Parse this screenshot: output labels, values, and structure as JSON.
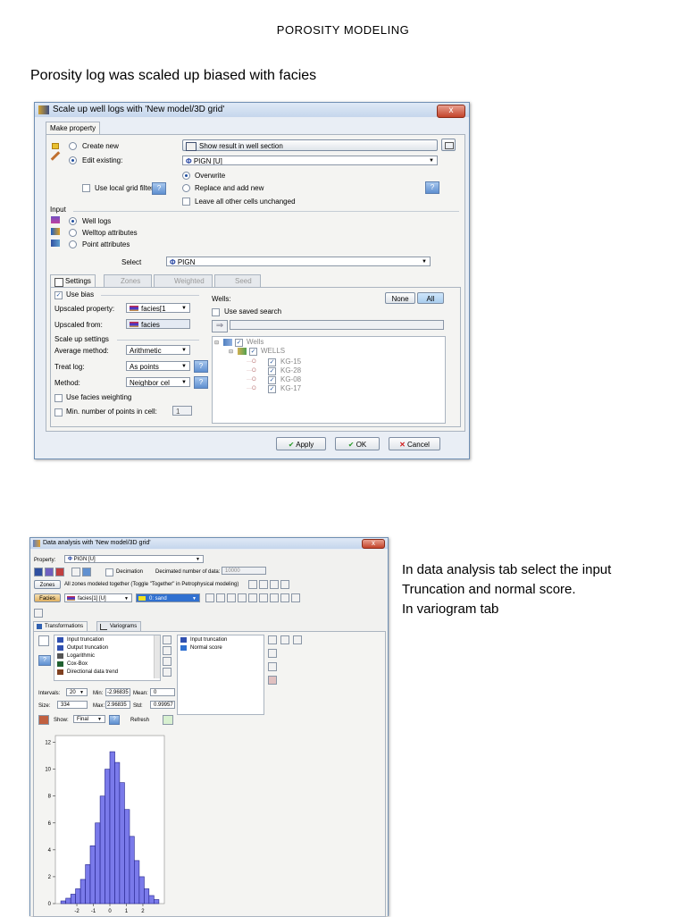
{
  "doc": {
    "title": "POROSITY MODELING",
    "subtitle": "Porosity log was scaled up biased with facies",
    "notes": [
      "In data analysis tab select the input",
      "Truncation and normal score.",
      "In variogram tab"
    ]
  },
  "dialog1": {
    "title": "Scale up well logs with 'New model/3D grid'",
    "close": "x",
    "make_property_tab": "Make property",
    "create_new": "Create new",
    "edit_existing": "Edit existing:",
    "use_local_grid_filter": "Use local grid filter",
    "show_result": "Show result in well section",
    "property_value": "PIGN [U]",
    "overwrite": "Overwrite",
    "replace_add_new": "Replace and add new",
    "leave_unchanged": "Leave all other cells unchanged",
    "input_label": "Input",
    "well_logs": "Well logs",
    "welltop_attributes": "Welltop attributes",
    "point_attributes": "Point attributes",
    "select_label": "Select",
    "select_value": "PIGN",
    "tabs": [
      "Settings",
      "Zones",
      "Weighted",
      "Seed"
    ],
    "use_bias": "Use bias",
    "upscaled_property_label": "Upscaled property:",
    "upscaled_property_value": "facies[1",
    "upscaled_from_label": "Upscaled from:",
    "upscaled_from_value": "facies",
    "scale_up_settings": "Scale up settings",
    "average_method_label": "Average method:",
    "average_method_value": "Arithmetic",
    "treat_log_label": "Treat log:",
    "treat_log_value": "As points",
    "method_label": "Method:",
    "method_value": "Neighbor cel",
    "use_facies_weighting": "Use facies weighting",
    "min_points_label": "Min. number of points in cell:",
    "min_points_value": "1",
    "wells_label": "Wells:",
    "none_btn": "None",
    "all_btn": "All",
    "use_saved_search": "Use saved search",
    "tree_root": "Wells",
    "tree_folder": "WELLS",
    "wells": [
      "KG-15",
      "KG-28",
      "KG-08",
      "KG-17"
    ],
    "apply": "Apply",
    "ok": "OK",
    "cancel": "Cancel",
    "help": "?"
  },
  "dialog2": {
    "title": "Data analysis with 'New model/3D grid'",
    "close": "x",
    "property_label": "Property:",
    "property_value": "PIGN [U]",
    "decimation": "Decimation",
    "decimated_label": "Decimated number of data:",
    "decimated_value": "10000",
    "zones_btn": "Zones",
    "zones_text": "All zones modeled together (Toggle \"Together\" in Petrophysical modeling)",
    "facies_btn": "Facies",
    "facies_value": "facies[1] [U]",
    "facies_code": "0: sand",
    "tabs": [
      "Transformations",
      "Variograms"
    ],
    "transform_list": [
      "Input truncation",
      "Output truncation",
      "Logarithmic",
      "Cox-Box",
      "Directional data trend"
    ],
    "applied_list": [
      "Input truncation",
      "Normal score"
    ],
    "intervals_label": "Intervals:",
    "intervals_value": "20",
    "min_label": "Min:",
    "min_value": "-2.96835",
    "mean_label": "Mean:",
    "mean_value": "0",
    "size_label": "Size:",
    "size_value": "334",
    "max_label": "Max:",
    "max_value": "2.96835",
    "std_label": "Std:",
    "std_value": "0.99957",
    "show_label": "Show:",
    "show_value": "Final",
    "refresh": "Refresh",
    "help": "?"
  },
  "chart_data": {
    "type": "bar",
    "xticks": [
      "-2",
      "-1",
      "0",
      "1",
      "2"
    ],
    "yticks": [
      "0",
      "2",
      "4",
      "6",
      "8",
      "10",
      "12"
    ],
    "xlim": [
      -3.3,
      3.3
    ],
    "ylim": [
      0,
      12.5
    ],
    "bins": [
      {
        "x0": -2.97,
        "x1": -2.67,
        "y": 0.2
      },
      {
        "x0": -2.67,
        "x1": -2.37,
        "y": 0.4
      },
      {
        "x0": -2.37,
        "x1": -2.08,
        "y": 0.7
      },
      {
        "x0": -2.08,
        "x1": -1.78,
        "y": 1.1
      },
      {
        "x0": -1.78,
        "x1": -1.48,
        "y": 1.8
      },
      {
        "x0": -1.48,
        "x1": -1.19,
        "y": 2.9
      },
      {
        "x0": -1.19,
        "x1": -0.89,
        "y": 4.3
      },
      {
        "x0": -0.89,
        "x1": -0.59,
        "y": 6.0
      },
      {
        "x0": -0.59,
        "x1": -0.3,
        "y": 8.0
      },
      {
        "x0": -0.3,
        "x1": 0.0,
        "y": 10.0
      },
      {
        "x0": 0.0,
        "x1": 0.3,
        "y": 11.3
      },
      {
        "x0": 0.3,
        "x1": 0.59,
        "y": 10.5
      },
      {
        "x0": 0.59,
        "x1": 0.89,
        "y": 9.0
      },
      {
        "x0": 0.89,
        "x1": 1.19,
        "y": 7.0
      },
      {
        "x0": 1.19,
        "x1": 1.48,
        "y": 5.0
      },
      {
        "x0": 1.48,
        "x1": 1.78,
        "y": 3.2
      },
      {
        "x0": 1.78,
        "x1": 2.08,
        "y": 2.0
      },
      {
        "x0": 2.08,
        "x1": 2.37,
        "y": 1.1
      },
      {
        "x0": 2.37,
        "x1": 2.67,
        "y": 0.6
      },
      {
        "x0": 2.67,
        "x1": 2.97,
        "y": 0.3
      }
    ]
  }
}
